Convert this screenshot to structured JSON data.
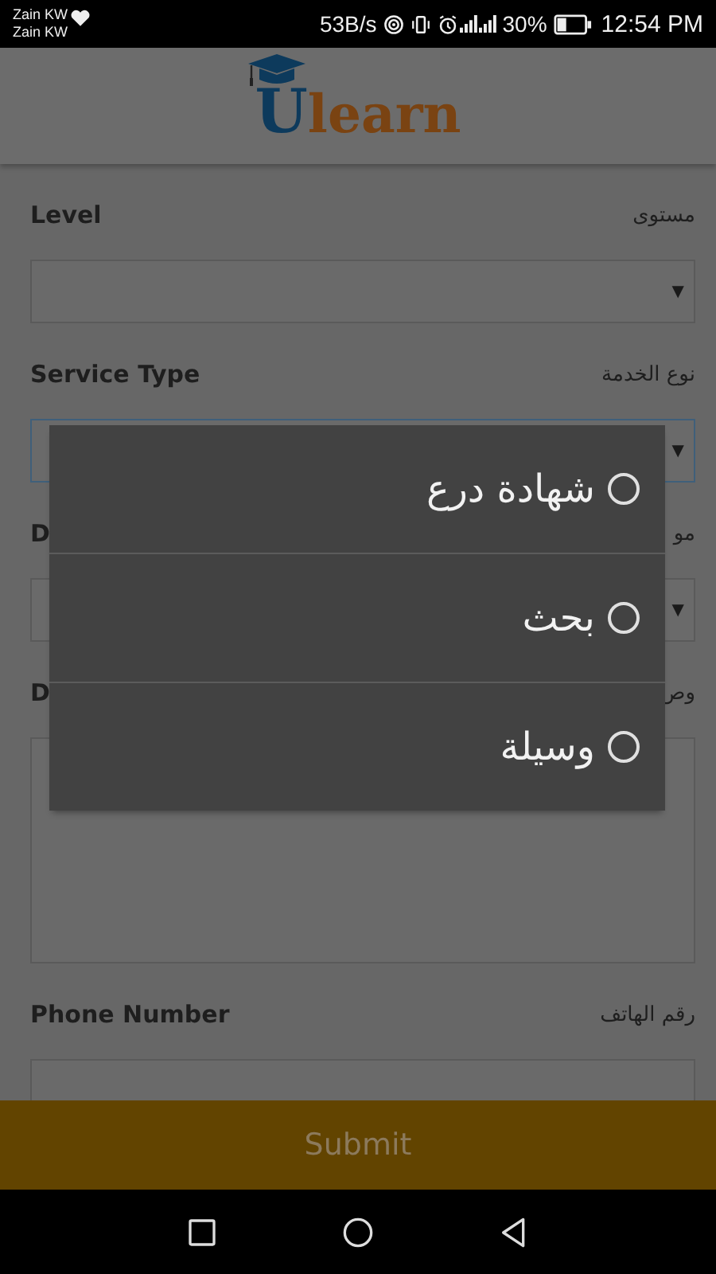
{
  "status_bar": {
    "carriers": [
      "Zain KW",
      "Zain KW"
    ],
    "speed": "53B/s",
    "battery_text": "30%",
    "time": "12:54 PM"
  },
  "header": {
    "logo_lead": "U",
    "logo_rest": "learn"
  },
  "form": {
    "fields": [
      {
        "label": "Level",
        "label_ar": "مستوى",
        "kind": "select",
        "focused": false,
        "arrow": "▼"
      },
      {
        "label": "Service Type",
        "label_ar": "نوع الخدمة",
        "kind": "select",
        "focused": true,
        "arrow": "▼"
      },
      {
        "label": "D",
        "label_ar": "مو",
        "kind": "select",
        "focused": false,
        "arrow": "▼"
      },
      {
        "label": "D",
        "label_ar": "وص",
        "kind": "textarea",
        "focused": false
      },
      {
        "label": "Phone Number",
        "label_ar": "رقم الهاتف",
        "kind": "input",
        "focused": false
      }
    ]
  },
  "submit": "Submit",
  "dialog": {
    "options": [
      {
        "label": "شهادة درع",
        "selected": false
      },
      {
        "label": "بحث",
        "selected": false
      },
      {
        "label": "وسيلة",
        "selected": false
      }
    ]
  }
}
